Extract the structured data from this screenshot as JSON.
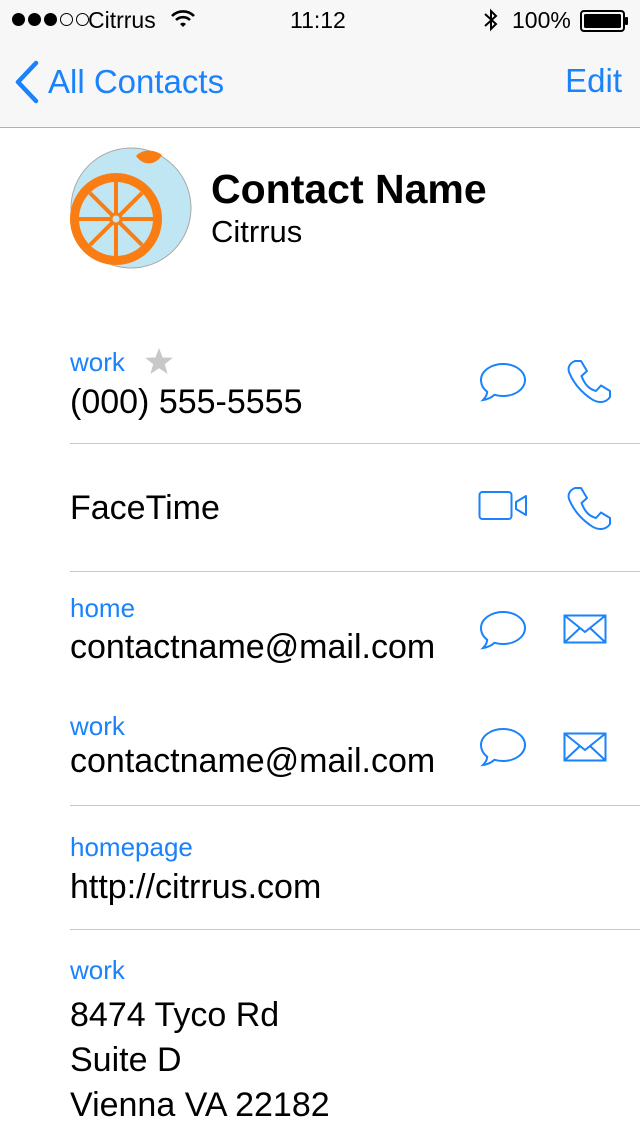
{
  "status_bar": {
    "carrier": "Citrrus",
    "time": "11:12",
    "battery": "100%"
  },
  "nav": {
    "back_label": "All Contacts",
    "edit_label": "Edit"
  },
  "contact": {
    "name": "Contact Name",
    "company": "Citrrus"
  },
  "phone": {
    "label": "work",
    "value": "(000) 555-5555"
  },
  "facetime": {
    "label": "FaceTime"
  },
  "emails": [
    {
      "label": "home",
      "value": "contactname@mail.com"
    },
    {
      "label": "work",
      "value": "contactname@mail.com"
    }
  ],
  "homepage": {
    "label": "homepage",
    "value": "http://citrrus.com"
  },
  "address": {
    "label": "work",
    "line1": "8474 Tyco Rd",
    "line2": "Suite D",
    "line3": "Vienna VA 22182"
  },
  "colors": {
    "accent": "#1a82fb",
    "avatar_orange": "#f97d12",
    "avatar_bg": "#bfe6f2",
    "star": "#c8c8c8"
  },
  "icons": [
    "wifi-icon",
    "bluetooth-icon",
    "battery-icon",
    "chevron-left-icon",
    "star-icon",
    "message-icon",
    "phone-icon",
    "video-icon",
    "mail-icon"
  ]
}
